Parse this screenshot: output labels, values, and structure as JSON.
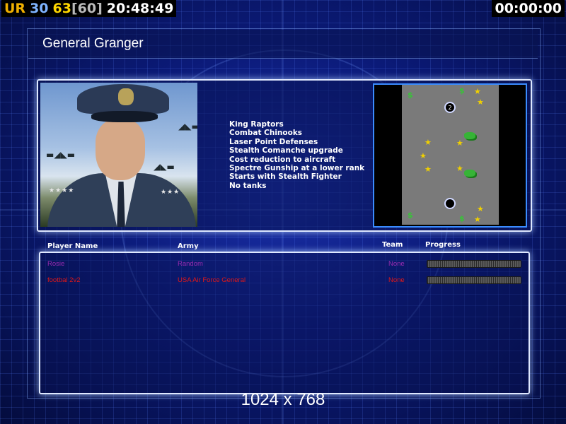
{
  "hud": {
    "ur": "UR",
    "val1": "30",
    "val2": "63",
    "val3": "[60]",
    "clock": "20:48:49",
    "timer": "00:00:00"
  },
  "title": "General Granger",
  "features": [
    "King Raptors",
    "Combat Chinooks",
    "Laser Point Defenses",
    "Stealth Comanche upgrade",
    "Cost reduction to aircraft",
    "Spectre Gunship at a lower rank",
    "Starts with Stealth Fighter",
    "No tanks"
  ],
  "minimap": {
    "start_label": "2"
  },
  "table": {
    "col_player": "Player Name",
    "col_army": "Army",
    "col_team": "Team",
    "col_progress": "Progress",
    "rows": [
      {
        "name": "Rosie",
        "army": "Random",
        "team": "None",
        "color": "#9a2bb0",
        "progress": 1.0
      },
      {
        "name": "footbal 2v2",
        "army": "USA Air Force General",
        "team": "None",
        "color": "#e01818",
        "progress": 1.0
      }
    ]
  },
  "resolution": "1024 x 768"
}
